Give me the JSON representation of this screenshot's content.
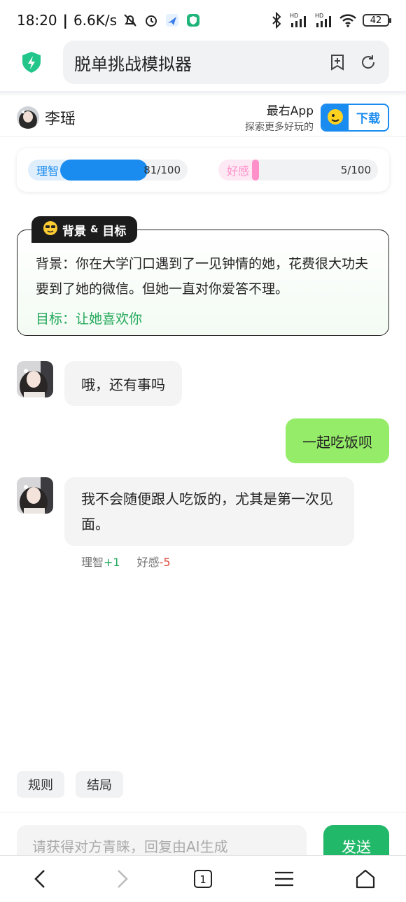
{
  "status_bar": {
    "time": "18:20",
    "speed": "6.6K/s",
    "battery": "42",
    "network_labels": [
      "HD",
      "HD"
    ]
  },
  "browser": {
    "address_title": "脱单挑战模拟器",
    "icons": [
      "shield-icon",
      "add-bookmark-icon",
      "refresh-icon"
    ]
  },
  "header": {
    "character_name": "李瑶",
    "promo_title": "最右App",
    "promo_subtitle": "探索更多好玩的",
    "download_label": "下载"
  },
  "stats": {
    "reason": {
      "label": "理智",
      "value_text": "81/100",
      "value": 81,
      "max": 100,
      "color": "#1a8cf0",
      "label_color": "#1a8cf0"
    },
    "favor": {
      "label": "好感",
      "value_text": "5/100",
      "value": 5,
      "max": 100,
      "color": "#ff8fc8",
      "label_color": "#ff8fc8"
    }
  },
  "scenario": {
    "tag_icon": "sunglasses-emoji-icon",
    "tag_label": "背景",
    "tag_amp": "&",
    "tag_goal": "目标",
    "background": "背景：你在大学门口遇到了一见钟情的她，花费很大功夫要到了她的微信。但她一直对你爱答不理。",
    "goal": "目标：让她喜欢你"
  },
  "messages": [
    {
      "from": "her",
      "text": "哦，还有事吗"
    },
    {
      "from": "me",
      "text": "一起吃饭呗"
    },
    {
      "from": "her",
      "text": "我不会随便跟人吃饭的，尤其是第一次见面。"
    }
  ],
  "delta": {
    "reason_label": "理智",
    "reason_change": "+1",
    "favor_label": "好感",
    "favor_change": "-5"
  },
  "chips": [
    "规则",
    "结局"
  ],
  "input": {
    "placeholder": "请获得对方青睐，回复由AI生成",
    "send_label": "发送"
  },
  "bottom_nav": {
    "tab_count": "1",
    "icons": [
      "back-icon",
      "forward-icon",
      "tabs-icon",
      "menu-icon",
      "home-icon"
    ]
  }
}
